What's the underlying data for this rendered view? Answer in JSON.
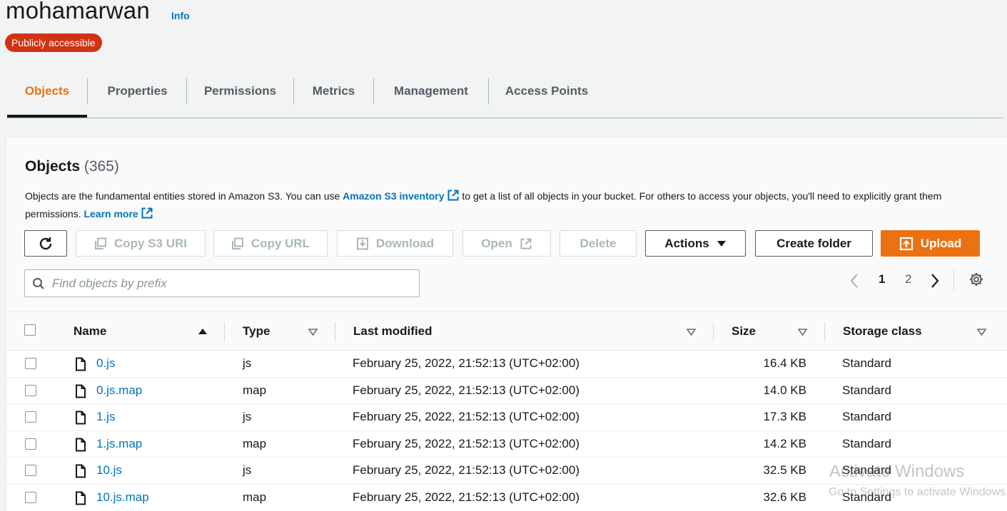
{
  "bucket": {
    "name": "mohamarwan",
    "info_label": "Info",
    "access_badge": "Publicly accessible"
  },
  "tabs": [
    {
      "label": "Objects",
      "active": true
    },
    {
      "label": "Properties"
    },
    {
      "label": "Permissions"
    },
    {
      "label": "Metrics"
    },
    {
      "label": "Management"
    },
    {
      "label": "Access Points"
    }
  ],
  "objects_panel": {
    "title": "Objects",
    "count": "(365)",
    "desc_part1": "Objects are the fundamental entities stored in Amazon S3. You can use ",
    "desc_link1": "Amazon S3 inventory",
    "desc_part2": " to get a list of all objects in your bucket. For others to access your objects, you'll need to explicitly grant them permissions. ",
    "desc_link2": "Learn more"
  },
  "toolbar": {
    "copy_s3_uri": "Copy S3 URI",
    "copy_url": "Copy URL",
    "download": "Download",
    "open": "Open",
    "delete": "Delete",
    "actions": "Actions",
    "create_folder": "Create folder",
    "upload": "Upload"
  },
  "search": {
    "placeholder": "Find objects by prefix"
  },
  "pagination": {
    "pages": [
      "1",
      "2"
    ],
    "current": "1"
  },
  "table": {
    "columns": {
      "name": "Name",
      "type": "Type",
      "last_modified": "Last modified",
      "size": "Size",
      "storage_class": "Storage class"
    },
    "rows": [
      {
        "name": "0.js",
        "type": "js",
        "last_modified": "February 25, 2022, 21:52:13 (UTC+02:00)",
        "size": "16.4 KB",
        "storage_class": "Standard"
      },
      {
        "name": "0.js.map",
        "type": "map",
        "last_modified": "February 25, 2022, 21:52:13 (UTC+02:00)",
        "size": "14.0 KB",
        "storage_class": "Standard"
      },
      {
        "name": "1.js",
        "type": "js",
        "last_modified": "February 25, 2022, 21:52:13 (UTC+02:00)",
        "size": "17.3 KB",
        "storage_class": "Standard"
      },
      {
        "name": "1.js.map",
        "type": "map",
        "last_modified": "February 25, 2022, 21:52:13 (UTC+02:00)",
        "size": "14.2 KB",
        "storage_class": "Standard"
      },
      {
        "name": "10.js",
        "type": "js",
        "last_modified": "February 25, 2022, 21:52:13 (UTC+02:00)",
        "size": "32.5 KB",
        "storage_class": "Standard"
      },
      {
        "name": "10.js.map",
        "type": "map",
        "last_modified": "February 25, 2022, 21:52:13 (UTC+02:00)",
        "size": "32.6 KB",
        "storage_class": "Standard"
      }
    ]
  },
  "watermark": {
    "line1": "Activate Windows",
    "line2": "Go to Settings to activate Windows."
  },
  "colors": {
    "accent": "#ec7211",
    "link": "#0073bb",
    "badge": "#d13212"
  }
}
